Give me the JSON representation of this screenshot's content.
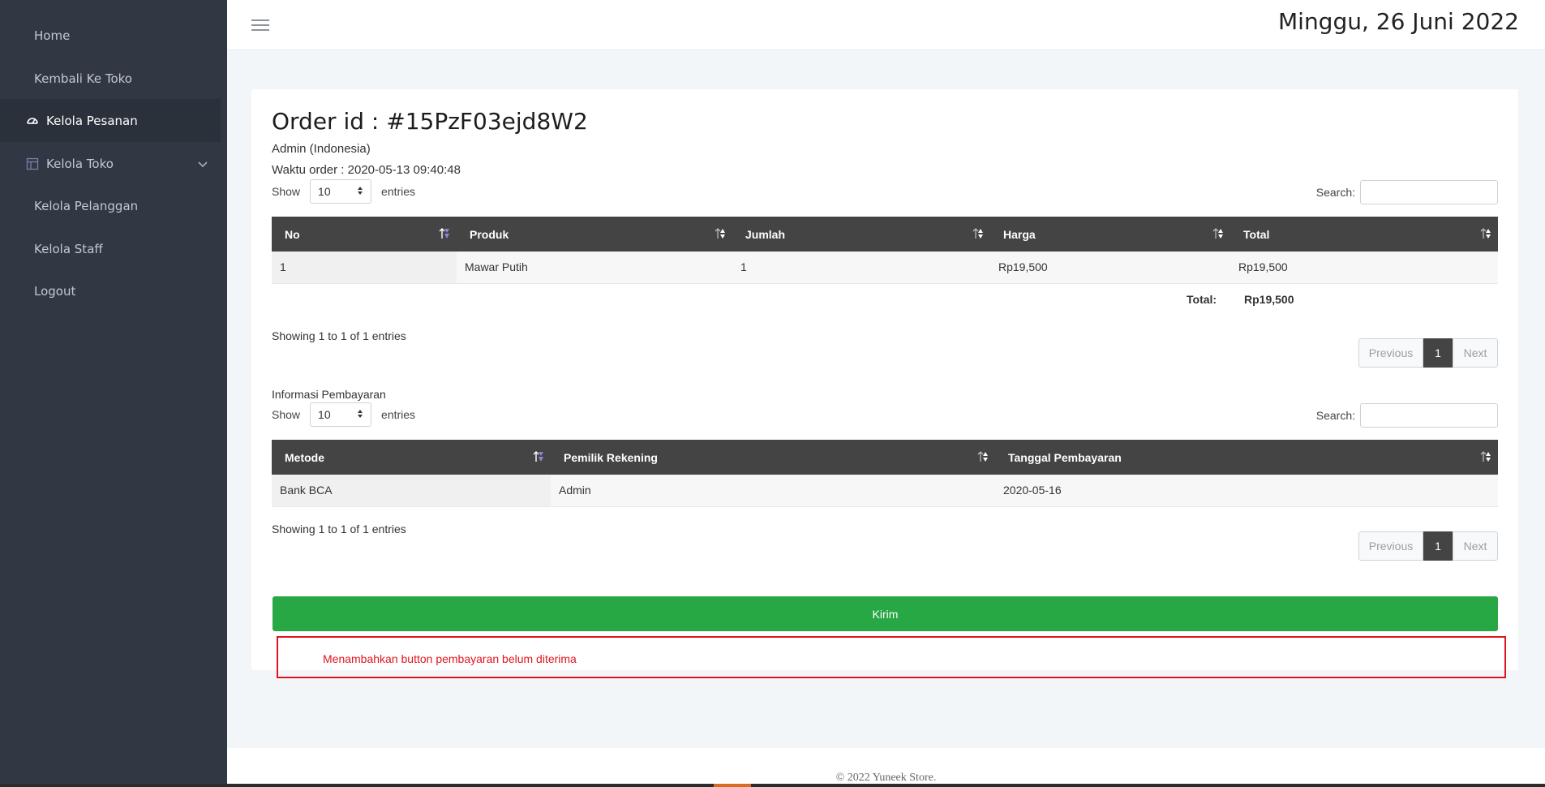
{
  "sidebar": {
    "items": [
      {
        "label": "Home"
      },
      {
        "label": "Kembali Ke Toko"
      },
      {
        "label": "Kelola Pesanan"
      },
      {
        "label": "Kelola Toko"
      },
      {
        "label": "Kelola Pelanggan"
      },
      {
        "label": "Kelola Staff"
      },
      {
        "label": "Logout"
      }
    ]
  },
  "header": {
    "date": "Minggu, 26 Juni 2022"
  },
  "order": {
    "title": "Order id : #15PzF03ejd8W2",
    "customer": "Admin (Indonesia)",
    "order_time": "Waktu order : 2020-05-13 09:40:48"
  },
  "products_table": {
    "show_label": "Show",
    "entries_label": "entries",
    "length_value": "10",
    "search_label": "Search:",
    "columns": [
      "No",
      "Produk",
      "Jumlah",
      "Harga",
      "Total"
    ],
    "rows": [
      [
        "1",
        "Mawar Putih",
        "1",
        "Rp19,500",
        "Rp19,500"
      ]
    ],
    "total_label": "Total:",
    "total_value": "Rp19,500",
    "info": "Showing 1 to 1 of 1 entries",
    "pager": {
      "prev": "Previous",
      "current": "1",
      "next": "Next"
    }
  },
  "payment_table": {
    "section_label": "Informasi Pembayaran",
    "show_label": "Show",
    "entries_label": "entries",
    "length_value": "10",
    "search_label": "Search:",
    "columns": [
      "Metode",
      "Pemilik Rekening",
      "Tanggal Pembayaran"
    ],
    "rows": [
      [
        "Bank BCA",
        "Admin",
        "2020-05-16"
      ]
    ],
    "info": "Showing 1 to 1 of 1 entries",
    "pager": {
      "prev": "Previous",
      "current": "1",
      "next": "Next"
    }
  },
  "actions": {
    "submit_label": "Kirim"
  },
  "annotation": {
    "text": "Menambahkan button pembayaran belum diterima"
  },
  "footer": {
    "copyright": "© 2022 Yuneek Store."
  },
  "colors": {
    "sidebar": "#313844",
    "table_header": "#444444",
    "submit": "#28a745",
    "annotation": "#e0141c"
  }
}
